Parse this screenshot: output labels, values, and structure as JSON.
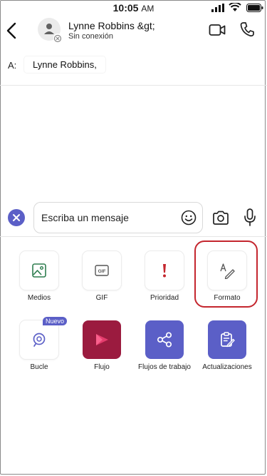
{
  "status_bar": {
    "time": "10:05",
    "ampm": "AM"
  },
  "header": {
    "contact_name": "Lynne Robbins &gt;",
    "contact_status": "Sin conexión"
  },
  "recipient": {
    "to_label": "A:",
    "name": "Lynne Robbins,"
  },
  "compose": {
    "placeholder": "Escriba un mensaje"
  },
  "actions": [
    {
      "label": "Medios",
      "icon": "image-icon"
    },
    {
      "label": "GIF",
      "icon": "gif-icon"
    },
    {
      "label": "Prioridad",
      "icon": "exclamation-icon"
    },
    {
      "label": "Formato",
      "icon": "format-pen-icon"
    },
    {
      "label": "Bucle",
      "icon": "loop-icon",
      "badge": "Nuevo"
    },
    {
      "label": "Flujo",
      "icon": "stream-icon"
    },
    {
      "label": "Flujos de trabajo",
      "icon": "workflows-icon"
    },
    {
      "label": "Actualizaciones",
      "icon": "updates-icon"
    }
  ],
  "colors": {
    "accent": "#5b5fc7",
    "priority": "#c4262e",
    "stream": "#9b1b3f",
    "media_icon": "#2e7d4f",
    "highlight": "#c4262e"
  }
}
